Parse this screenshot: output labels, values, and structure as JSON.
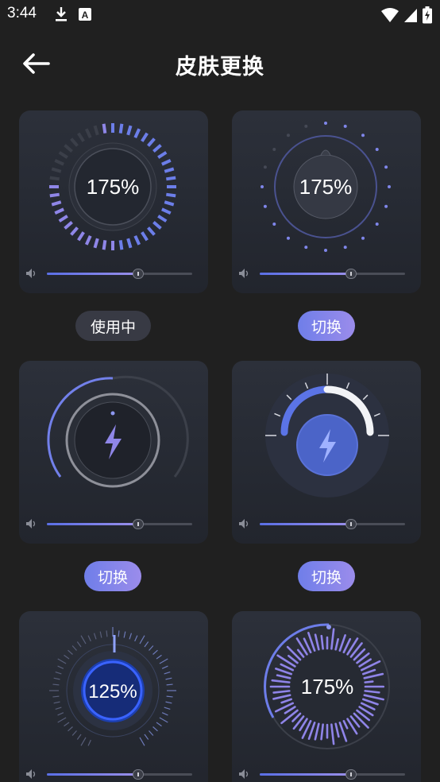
{
  "status_bar": {
    "time": "3:44",
    "icons": [
      "download-icon",
      "a-box-icon",
      "wifi-icon",
      "signal-icon",
      "battery-icon"
    ]
  },
  "header": {
    "title": "皮肤更换",
    "back_icon": "arrow-left-icon"
  },
  "skins": [
    {
      "id": 1,
      "label": "175%",
      "volume": 0.63,
      "action": "使用中",
      "state": "active"
    },
    {
      "id": 2,
      "label": "175%",
      "volume": 0.63,
      "action": "切换",
      "state": "switch"
    },
    {
      "id": 3,
      "label": "",
      "icon": "lightning-icon",
      "volume": 0.63,
      "action": "切换",
      "state": "switch"
    },
    {
      "id": 4,
      "label": "",
      "icon": "lightning-icon",
      "volume": 0.63,
      "action": "切换",
      "state": "switch"
    },
    {
      "id": 5,
      "label": "125%",
      "volume": 0.63
    },
    {
      "id": 6,
      "label": "175%",
      "volume": 0.63
    }
  ],
  "colors": {
    "background": "#202020",
    "card": "#2a2e37",
    "accent_blue": "#5a6fe6",
    "accent_purple": "#9a8fe9",
    "active_pill": "#383a44"
  }
}
